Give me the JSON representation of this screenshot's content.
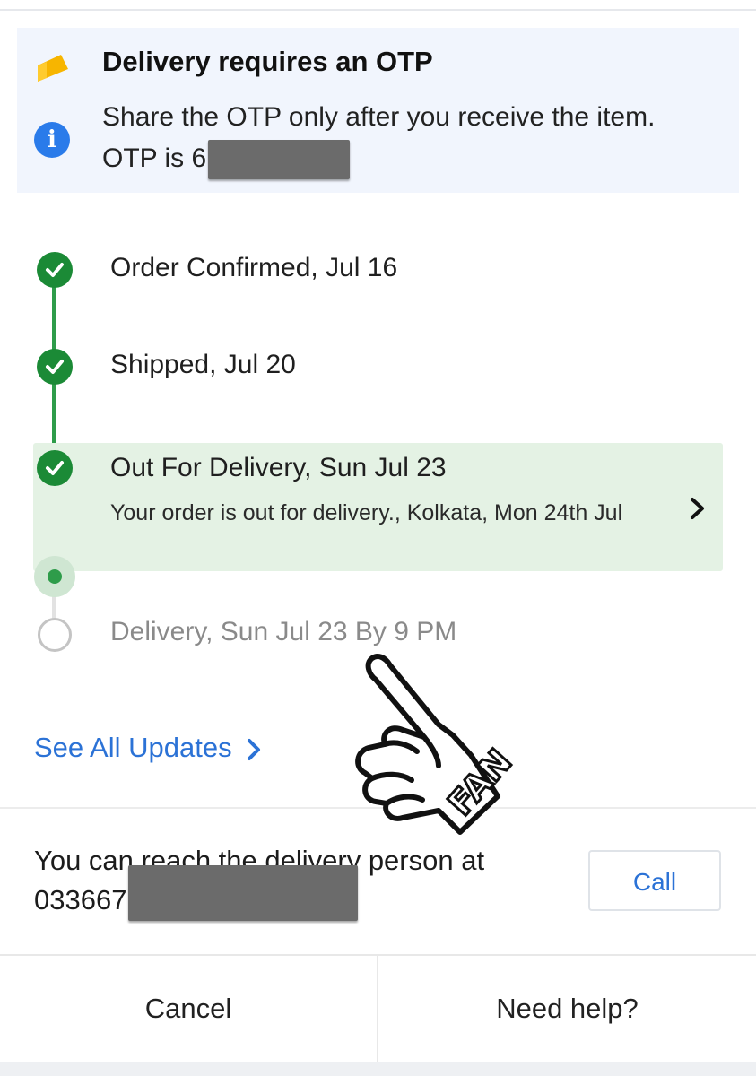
{
  "otp_banner": {
    "title": "Delivery requires an OTP",
    "message": "Share the OTP only after you receive the item. OTP is 6",
    "flag_icon": "flag-icon",
    "info_icon": "info-icon",
    "info_glyph": "i"
  },
  "timeline": {
    "steps": [
      {
        "label": "Order Confirmed, Jul 16",
        "status": "done"
      },
      {
        "label": "Shipped, Jul 20",
        "status": "done"
      },
      {
        "label": "Out For Delivery, Sun Jul 23",
        "status": "current",
        "detail": "Your order is out for delivery., Kolkata, Mon 24th Jul"
      },
      {
        "label": "Delivery, Sun Jul 23 By 9 PM",
        "status": "pending"
      }
    ]
  },
  "see_all": {
    "label": "See All Updates"
  },
  "contact": {
    "text": "You can reach the delivery person at",
    "phone_prefix": "033667",
    "call_label": "Call"
  },
  "actions": {
    "cancel_label": "Cancel",
    "help_label": "Need help?"
  },
  "sticker": {
    "text": "FAN"
  },
  "colors": {
    "accent_blue": "#2b72d6",
    "success_green": "#1b8a36",
    "highlight_green": "#e4f2e4",
    "banner_bg": "#f1f5fd",
    "flag_yellow": "#f7b500"
  }
}
